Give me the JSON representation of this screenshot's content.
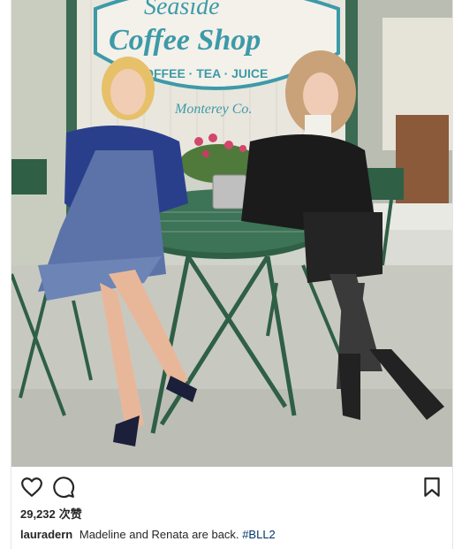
{
  "photo": {
    "sign_line1": "Seaside",
    "sign_line2": "Coffee Shop",
    "sign_line3": "COFFEE · TEA · JUICE",
    "sign_line4": "Monterey Co.",
    "alt": "Madeline and Renata are back."
  },
  "actions": {
    "like_icon": "heart-outline-icon",
    "comment_icon": "speech-bubble-icon",
    "bookmark_icon": "bookmark-outline-icon"
  },
  "likes": {
    "count": "29,232",
    "label": "次赞"
  },
  "caption": {
    "username": "lauradern",
    "text": "Madeline and Renata are back.",
    "hashtag": "#BLL2"
  },
  "colors": {
    "sign_teal": "#3d9aa8",
    "table_green": "#2f5f45",
    "accent_link": "#003569"
  }
}
